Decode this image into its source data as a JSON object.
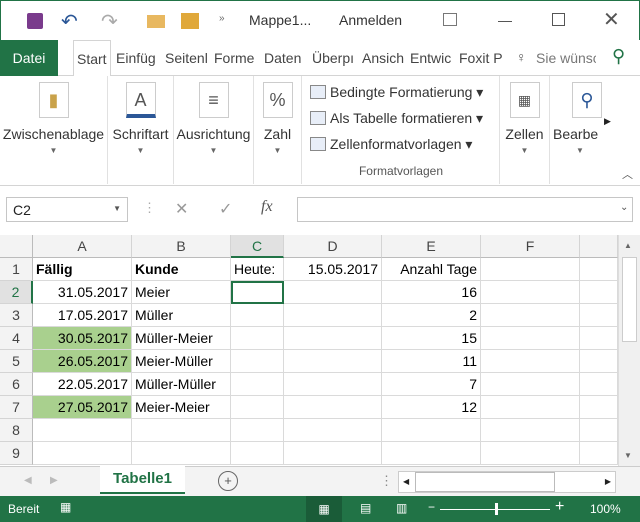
{
  "titlebar": {
    "title": "Mappe1...",
    "signin": "Anmelden"
  },
  "tabs": {
    "file": "Datei",
    "items": [
      "Start",
      "Einfüg",
      "Seitenl",
      "Forme",
      "Daten",
      "Überpı",
      "Ansich",
      "Entwic",
      "Foxit P"
    ],
    "tellme": "Sie wünsc"
  },
  "ribbon": {
    "groups": [
      "Zwischenablage",
      "Schriftart",
      "Ausrichtung",
      "Zahl"
    ],
    "styles": [
      "Bedingte Formatierung",
      "Als Tabelle formatieren",
      "Zellenformatvorlagen"
    ],
    "styles_group": "Formatvorlagen",
    "cells": "Zellen",
    "edit": "Bearbe"
  },
  "formula": {
    "namebox": "C2",
    "fx": "fx",
    "value": ""
  },
  "columns": [
    "A",
    "B",
    "C",
    "D",
    "E",
    "F"
  ],
  "rows": [
    "1",
    "2",
    "3",
    "4",
    "5",
    "6",
    "7",
    "8",
    "9"
  ],
  "cells": {
    "r1": [
      "Fällig",
      "Kunde",
      "Heute:",
      "15.05.2017",
      "Anzahl Tage"
    ],
    "data": [
      [
        "31.05.2017",
        "Meier",
        "16"
      ],
      [
        "17.05.2017",
        "Müller",
        "2"
      ],
      [
        "30.05.2017",
        "Müller-Meier",
        "15"
      ],
      [
        "26.05.2017",
        "Meier-Müller",
        "11"
      ],
      [
        "22.05.2017",
        "Müller-Müller",
        "7"
      ],
      [
        "27.05.2017",
        "Meier-Meier",
        "12"
      ]
    ],
    "highlighted_rows": [
      2,
      3,
      5
    ],
    "highlight_color": "#a9d08e"
  },
  "sheet": {
    "tab": "Tabelle1"
  },
  "status": {
    "ready": "Bereit",
    "zoom": "100%"
  }
}
